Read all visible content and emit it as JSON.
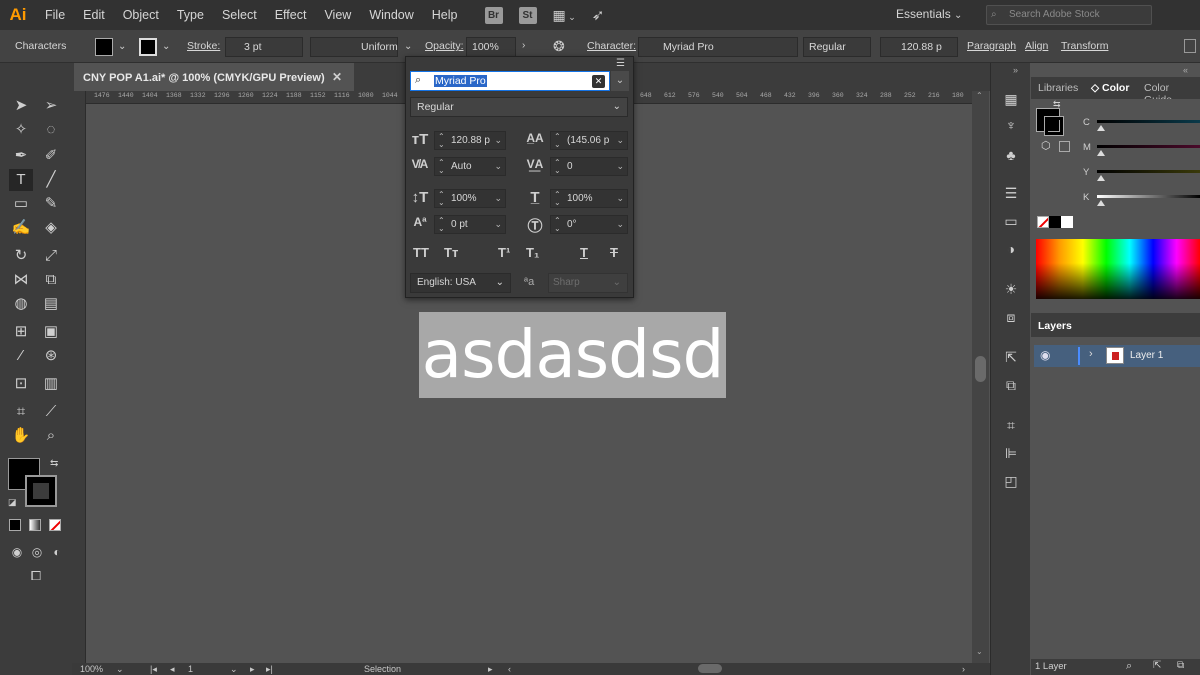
{
  "app": {
    "logo": "Ai"
  },
  "menu": [
    "File",
    "Edit",
    "Object",
    "Type",
    "Select",
    "Effect",
    "View",
    "Window",
    "Help"
  ],
  "app_buttons": [
    "Br",
    "St"
  ],
  "workspace": {
    "label": "Essentials"
  },
  "stock_search": {
    "placeholder": "Search Adobe Stock"
  },
  "control_bar": {
    "mode_label": "Characters",
    "stroke_label": "Stroke:",
    "stroke_value": "3 pt",
    "profile_label": "Uniform",
    "opacity_label": "Opacity:",
    "opacity_value": "100%",
    "character_label": "Character:",
    "font_value": "Myriad Pro",
    "style_value": "Regular",
    "size_value": "120.88 p",
    "paragraph_label": "Paragraph",
    "align_label": "Align",
    "transform_label": "Transform"
  },
  "document": {
    "tab_title": "CNY POP A1.ai* @ 100% (CMYK/GPU Preview)"
  },
  "ruler_ticks": [
    "1476",
    "1440",
    "1404",
    "1368",
    "1332",
    "1296",
    "1260",
    "1224",
    "1188",
    "1152",
    "1116",
    "1080",
    "1044",
    "648",
    "612",
    "576",
    "540",
    "504",
    "468",
    "432",
    "396",
    "360",
    "324",
    "288",
    "252",
    "216",
    "180"
  ],
  "canvas": {
    "text_content": "asdasdsd"
  },
  "character_popup": {
    "font_search": "Myriad Pro",
    "font_style": "Regular",
    "font_size": "120.88 p",
    "leading": "(145.06 p",
    "kerning": "Auto",
    "tracking": "0",
    "vertical_scale": "100%",
    "horizontal_scale": "100%",
    "baseline_shift": "0 pt",
    "rotation": "0°",
    "language": "English: USA",
    "anti_alias": "Sharp"
  },
  "status_bar": {
    "zoom": "100%",
    "artboard": "1",
    "tool": "Selection"
  },
  "right_panel": {
    "tabs": [
      "Libraries",
      "Color",
      "Color Guide"
    ],
    "cmyk_labels": [
      "C",
      "M",
      "Y",
      "K"
    ],
    "layers_tab": "Layers",
    "layer_name": "Layer 1",
    "layer_count": "1 Layer"
  },
  "colors": {
    "accent": "#1473e6",
    "selection": "#2a67c8",
    "logo": "#ff9a00",
    "text_highlight": "#a8a8a8"
  }
}
